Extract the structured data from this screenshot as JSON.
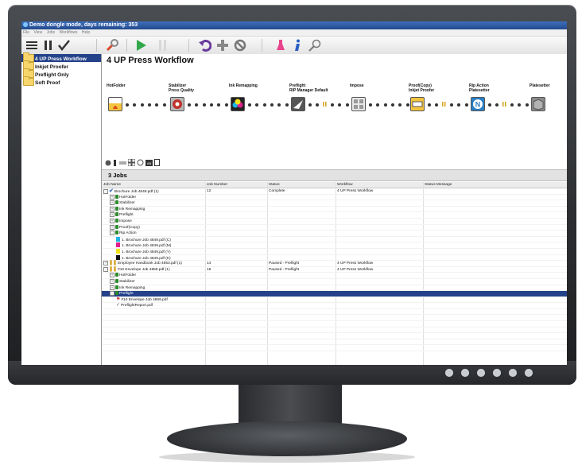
{
  "window": {
    "title": "Demo dongle mode, days remaining: 353"
  },
  "menu": [
    "File",
    "View",
    "Jobs",
    "Workflows",
    "Help"
  ],
  "toolbar_icons": [
    "list-icon",
    "pause-icon",
    "checkmark-icon",
    "wrench-icon",
    "play-icon",
    "hold-icon",
    "undo-icon",
    "add-icon",
    "cancel-icon",
    "flask-icon",
    "info-icon",
    "search-icon"
  ],
  "workflows": [
    "4 UP Press Workflow",
    "Inkjet Proofer",
    "Preflight Only",
    "Soft Proof"
  ],
  "workflow_title": "4 UP Press Workflow",
  "stages": [
    {
      "name": "HotFolder",
      "sub": ""
    },
    {
      "name": "Stabilizer",
      "sub": "Press Quality"
    },
    {
      "name": "Ink Remapping",
      "sub": ""
    },
    {
      "name": "Preflight",
      "sub": "RIP Manager Default"
    },
    {
      "name": "Impose",
      "sub": ""
    },
    {
      "name": "Proof(Copy)",
      "sub": "Inkjet Proofer"
    },
    {
      "name": "Rip Action",
      "sub": "Platesetter"
    },
    {
      "name": "Platesetter",
      "sub": ""
    }
  ],
  "jobs_count": "3 Jobs",
  "columns": [
    "Job Name",
    "Job Number",
    "Status",
    "Workflow",
    "Status Message"
  ],
  "rows": [
    {
      "indent": 0,
      "icon": "check",
      "exp": "-",
      "name": "Brochure Job 4849.pdf (1)",
      "number": "12",
      "status": "Complete",
      "workflow": "4 UP Press Workflow"
    },
    {
      "indent": 1,
      "icon": "step",
      "exp": "+",
      "name": "HotFolder"
    },
    {
      "indent": 1,
      "icon": "step",
      "exp": "+",
      "name": "Stabilizer"
    },
    {
      "indent": 1,
      "icon": "step",
      "exp": "+",
      "name": "Ink Remapping"
    },
    {
      "indent": 1,
      "icon": "step",
      "exp": "+",
      "name": "Preflight"
    },
    {
      "indent": 1,
      "icon": "step",
      "exp": "+",
      "name": "Impose"
    },
    {
      "indent": 1,
      "icon": "step",
      "exp": "+",
      "name": "Proof(Copy)"
    },
    {
      "indent": 1,
      "icon": "step",
      "exp": "-",
      "name": "Rip Action"
    },
    {
      "indent": 2,
      "icon": "swatch",
      "color": "#1fb4e6",
      "name": "1. Brochure Job 4849.pdf (C)"
    },
    {
      "indent": 2,
      "icon": "swatch",
      "color": "#e0208c",
      "name": "1. Brochure Job 4849.pdf (M)"
    },
    {
      "indent": 2,
      "icon": "swatch",
      "color": "#f2e31b",
      "name": "1. Brochure Job 4849.pdf (Y)"
    },
    {
      "indent": 2,
      "icon": "swatch",
      "color": "#111111",
      "name": "1. Brochure Job 4849.pdf (K)"
    },
    {
      "indent": 0,
      "icon": "pause",
      "exp": "+",
      "name": "Employee Handbook Job 4853.pdf (1)",
      "number": "14",
      "status": "Paused - Preflight",
      "workflow": "4 UP Press Workflow"
    },
    {
      "indent": 0,
      "icon": "pause",
      "exp": "-",
      "name": "#10 Envelope Job 4859.pdf (1)",
      "number": "15",
      "status": "Paused - Preflight",
      "workflow": "4 UP Press Workflow"
    },
    {
      "indent": 1,
      "icon": "step",
      "exp": "+",
      "name": "HotFolder"
    },
    {
      "indent": 1,
      "icon": "step",
      "exp": "+",
      "name": "Stabilizer"
    },
    {
      "indent": 1,
      "icon": "step",
      "exp": "+",
      "name": "Ink Remapping"
    },
    {
      "indent": 1,
      "icon": "step",
      "exp": "-",
      "name": "Preflight",
      "selected": true
    },
    {
      "indent": 2,
      "icon": "pdf",
      "name": "#10 Envelope Job 4859.pdf"
    },
    {
      "indent": 2,
      "icon": "report",
      "name": "PreflightReport.pdf"
    }
  ]
}
